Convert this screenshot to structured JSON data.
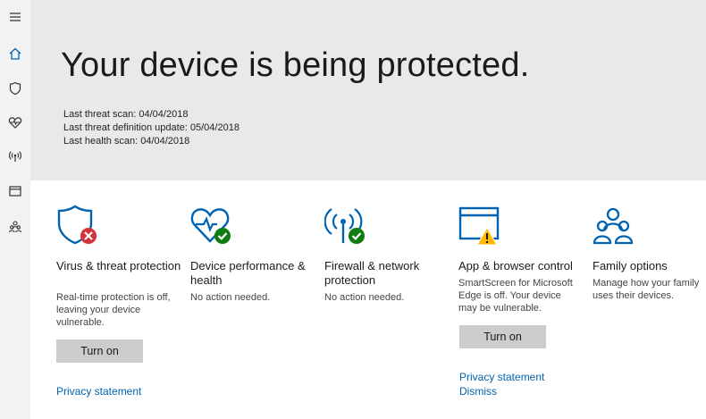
{
  "sidebar": {
    "items": [
      {
        "icon": "hamburger-icon"
      },
      {
        "icon": "home-icon",
        "active": true
      },
      {
        "icon": "shield-icon"
      },
      {
        "icon": "heart-pulse-icon"
      },
      {
        "icon": "antenna-icon"
      },
      {
        "icon": "browser-window-icon"
      },
      {
        "icon": "family-icon"
      }
    ]
  },
  "hero": {
    "title": "Your device is being protected.",
    "scan_lines": [
      "Last threat scan:  04/04/2018",
      "Last threat definition update:  05/04/2018",
      "Last health scan:  04/04/2018"
    ]
  },
  "tiles": [
    {
      "icon": "shield-error-icon",
      "title": "Virus & threat protection",
      "description": "Real-time protection is off, leaving your device vulnerable.",
      "button": "Turn on",
      "links": [
        "Privacy statement"
      ],
      "status": "error"
    },
    {
      "icon": "heart-check-icon",
      "title": "Device performance & health",
      "description": "No action needed.",
      "status": "ok"
    },
    {
      "icon": "firewall-check-icon",
      "title": "Firewall & network protection",
      "description": "No action needed.",
      "status": "ok"
    },
    {
      "icon": "browser-warning-icon",
      "title": "App & browser control",
      "description": "SmartScreen for Microsoft Edge is off.  Your device may be vulnerable.",
      "button": "Turn on",
      "links": [
        "Privacy statement",
        "Dismiss"
      ],
      "status": "warning"
    },
    {
      "icon": "family-icon",
      "title": "Family options",
      "description": "Manage how your family uses their devices."
    }
  ],
  "colors": {
    "accent": "#0063b1",
    "error": "#d13438",
    "ok": "#107c10",
    "warning": "#ffb900",
    "hero_bg": "#e9e9e9",
    "sidebar_bg": "#f2f2f2",
    "button_bg": "#cccccc"
  }
}
